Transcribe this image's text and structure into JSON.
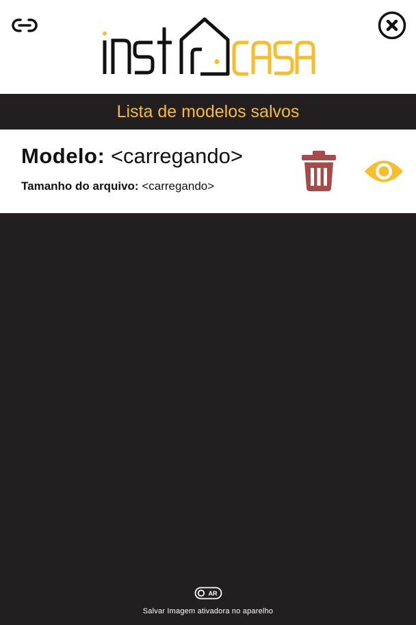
{
  "header": {
    "logo": {
      "part1": "INST",
      "part2": "CASA",
      "alt": "instacasa"
    },
    "link_icon": "link-icon",
    "close_icon": "close-icon"
  },
  "list": {
    "title": "Lista de modelos salvos",
    "items": [
      {
        "model_label": "Modelo:",
        "model_value": "<carregando>",
        "size_label": "Tamanho do arquivo:",
        "size_value": "<carregando>",
        "delete_icon": "trash-icon",
        "view_icon": "eye-icon"
      }
    ]
  },
  "footer": {
    "ar_icon": "ar-toggle-icon",
    "ar_label": "AR",
    "text": "Salvar Imagem ativadora no aparelho"
  },
  "colors": {
    "accent": "#f8bd2c",
    "dark": "#231f20",
    "delete": "#a84a4a",
    "white": "#ffffff"
  }
}
